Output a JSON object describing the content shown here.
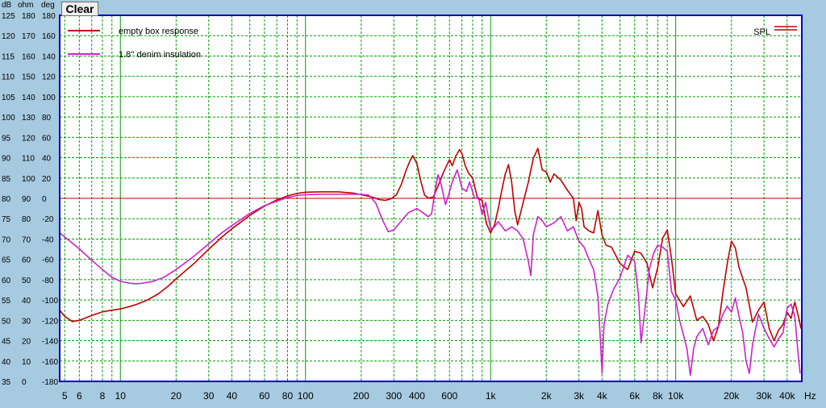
{
  "toolbar": {
    "clear_label": "Clear"
  },
  "axis_headers": {
    "db": "dB",
    "ohm": "ohm",
    "deg": "deg"
  },
  "colors": {
    "background": "#a6cae0",
    "plot_bg": "#ffffff",
    "grid": "#00a000",
    "frame": "#0000c0",
    "empty_box": "#c00000",
    "denim": "#d020d0",
    "reference": "#c00000"
  },
  "chart_data": {
    "type": "line",
    "title": "",
    "xlabel": "Hz",
    "x_scale": "log",
    "xlim": [
      4.7,
      48000
    ],
    "ylim_db": [
      35,
      125
    ],
    "grid": true,
    "legend_position": "top-left",
    "x_ticks": [
      {
        "v": 5,
        "label": "5"
      },
      {
        "v": 6,
        "label": "6"
      },
      {
        "v": 8,
        "label": "8"
      },
      {
        "v": 10,
        "label": "10"
      },
      {
        "v": 20,
        "label": "20"
      },
      {
        "v": 30,
        "label": "30"
      },
      {
        "v": 40,
        "label": "40"
      },
      {
        "v": 60,
        "label": "60"
      },
      {
        "v": 80,
        "label": "80"
      },
      {
        "v": 100,
        "label": "100"
      },
      {
        "v": 200,
        "label": "200"
      },
      {
        "v": 300,
        "label": "300"
      },
      {
        "v": 400,
        "label": "400"
      },
      {
        "v": 600,
        "label": "600"
      },
      {
        "v": 1000,
        "label": "1k"
      },
      {
        "v": 2000,
        "label": "2k"
      },
      {
        "v": 3000,
        "label": "3k"
      },
      {
        "v": 4000,
        "label": "4k"
      },
      {
        "v": 6000,
        "label": "6k"
      },
      {
        "v": 8000,
        "label": "8k"
      },
      {
        "v": 10000,
        "label": "10k"
      },
      {
        "v": 20000,
        "label": "20k"
      },
      {
        "v": 30000,
        "label": "30k"
      },
      {
        "v": 40000,
        "label": "40k"
      }
    ],
    "y_db_ticks": [
      "125",
      "120",
      "115",
      "110",
      "105",
      "100",
      "95",
      "90",
      "85",
      "80",
      "75",
      "70",
      "65",
      "60",
      "55",
      "50",
      "45",
      "40",
      "35"
    ],
    "y_ohm_ticks": [
      "180",
      "170",
      "160",
      "150",
      "140",
      "130",
      "120",
      "110",
      "100",
      "90",
      "80",
      "70",
      "60",
      "50",
      "40",
      "30",
      "20",
      "10",
      "0"
    ],
    "y_deg_ticks": [
      "180",
      "160",
      "140",
      "120",
      "100",
      "80",
      "60",
      "40",
      "20",
      "0",
      "-20",
      "-40",
      "-60",
      "-80",
      "-100",
      "-120",
      "-140",
      "-160",
      "-180"
    ],
    "reference_line_db": 80,
    "reference_label": "SPL",
    "series": [
      {
        "name": "empty box response",
        "color": "#c00000",
        "points": [
          [
            4.7,
            52.5
          ],
          [
            5,
            51
          ],
          [
            5.5,
            49.7
          ],
          [
            6,
            50
          ],
          [
            6.5,
            50.6
          ],
          [
            7,
            51.2
          ],
          [
            8,
            52.1
          ],
          [
            9,
            52.5
          ],
          [
            10,
            52.8
          ],
          [
            11,
            53.3
          ],
          [
            12,
            53.8
          ],
          [
            14,
            55
          ],
          [
            16,
            56.5
          ],
          [
            18,
            58.3
          ],
          [
            20,
            60.2
          ],
          [
            25,
            64
          ],
          [
            30,
            67.5
          ],
          [
            35,
            70.3
          ],
          [
            40,
            72.5
          ],
          [
            50,
            75.8
          ],
          [
            60,
            78.1
          ],
          [
            70,
            79.6
          ],
          [
            80,
            80.6
          ],
          [
            90,
            81.2
          ],
          [
            100,
            81.5
          ],
          [
            120,
            81.6
          ],
          [
            150,
            81.6
          ],
          [
            180,
            81.3
          ],
          [
            200,
            80.9
          ],
          [
            230,
            80.3
          ],
          [
            250,
            79.7
          ],
          [
            270,
            79.5
          ],
          [
            290,
            79.9
          ],
          [
            310,
            80.9
          ],
          [
            330,
            83.5
          ],
          [
            350,
            87
          ],
          [
            370,
            89.6
          ],
          [
            380,
            90.5
          ],
          [
            400,
            88.5
          ],
          [
            420,
            84.2
          ],
          [
            440,
            80.8
          ],
          [
            460,
            80.1
          ],
          [
            490,
            80.3
          ],
          [
            520,
            83
          ],
          [
            560,
            86.7
          ],
          [
            600,
            89.5
          ],
          [
            620,
            88
          ],
          [
            650,
            90.5
          ],
          [
            680,
            92
          ],
          [
            700,
            91
          ],
          [
            730,
            88
          ],
          [
            760,
            86.2
          ],
          [
            800,
            85
          ],
          [
            850,
            80
          ],
          [
            900,
            79.5
          ],
          [
            950,
            73.8
          ],
          [
            1000,
            71.5
          ],
          [
            1050,
            73.5
          ],
          [
            1100,
            77.5
          ],
          [
            1150,
            82
          ],
          [
            1200,
            86
          ],
          [
            1250,
            88.3
          ],
          [
            1300,
            84
          ],
          [
            1350,
            77
          ],
          [
            1400,
            73.5
          ],
          [
            1500,
            79
          ],
          [
            1600,
            84
          ],
          [
            1700,
            89.8
          ],
          [
            1800,
            92.3
          ],
          [
            1900,
            87
          ],
          [
            2000,
            86.5
          ],
          [
            2100,
            84
          ],
          [
            2200,
            86
          ],
          [
            2400,
            84.5
          ],
          [
            2600,
            82
          ],
          [
            2800,
            80
          ],
          [
            2900,
            74.5
          ],
          [
            3000,
            79
          ],
          [
            3100,
            77.5
          ],
          [
            3200,
            73
          ],
          [
            3400,
            72
          ],
          [
            3600,
            71.5
          ],
          [
            3800,
            77
          ],
          [
            4000,
            71
          ],
          [
            4200,
            68.5
          ],
          [
            4500,
            68
          ],
          [
            5000,
            64
          ],
          [
            5500,
            62.5
          ],
          [
            6000,
            67
          ],
          [
            6500,
            66.5
          ],
          [
            7000,
            64
          ],
          [
            7500,
            58
          ],
          [
            8000,
            63
          ],
          [
            8500,
            70.2
          ],
          [
            9000,
            72.2
          ],
          [
            9500,
            65
          ],
          [
            10000,
            56.5
          ],
          [
            11000,
            53.4
          ],
          [
            12000,
            56
          ],
          [
            13000,
            50
          ],
          [
            14000,
            51
          ],
          [
            15000,
            49
          ],
          [
            16000,
            45
          ],
          [
            17000,
            48.5
          ],
          [
            18000,
            57
          ],
          [
            19000,
            64
          ],
          [
            20000,
            69.5
          ],
          [
            21000,
            67.8
          ],
          [
            22000,
            63
          ],
          [
            24000,
            58
          ],
          [
            26000,
            49.6
          ],
          [
            28000,
            52.5
          ],
          [
            30000,
            54.5
          ],
          [
            32000,
            48
          ],
          [
            34000,
            45
          ],
          [
            36000,
            47.6
          ],
          [
            38000,
            49
          ],
          [
            40000,
            52
          ],
          [
            42000,
            50.5
          ],
          [
            44000,
            54.5
          ],
          [
            46000,
            51
          ],
          [
            47500,
            48
          ]
        ]
      },
      {
        "name": "1.8'' denim insulation",
        "color": "#d020d0",
        "points": [
          [
            4.7,
            71.5
          ],
          [
            5,
            70.5
          ],
          [
            6,
            67.6
          ],
          [
            7,
            64.8
          ],
          [
            8,
            62.5
          ],
          [
            9,
            60.6
          ],
          [
            10,
            59.6
          ],
          [
            11,
            59.2
          ],
          [
            12,
            59
          ],
          [
            13,
            59.1
          ],
          [
            15,
            59.6
          ],
          [
            17,
            60.5
          ],
          [
            20,
            62.5
          ],
          [
            25,
            65.8
          ],
          [
            30,
            68.8
          ],
          [
            35,
            71.4
          ],
          [
            40,
            73.3
          ],
          [
            50,
            76.3
          ],
          [
            60,
            78.2
          ],
          [
            70,
            79.3
          ],
          [
            80,
            80.2
          ],
          [
            90,
            80.7
          ],
          [
            100,
            80.9
          ],
          [
            120,
            81
          ],
          [
            150,
            81
          ],
          [
            180,
            81
          ],
          [
            200,
            81
          ],
          [
            220,
            80.8
          ],
          [
            240,
            78.8
          ],
          [
            260,
            74.8
          ],
          [
            280,
            71.8
          ],
          [
            300,
            72.2
          ],
          [
            330,
            74.5
          ],
          [
            360,
            76.5
          ],
          [
            400,
            77.5
          ],
          [
            430,
            76.5
          ],
          [
            460,
            75.5
          ],
          [
            480,
            76.2
          ],
          [
            500,
            81.5
          ],
          [
            520,
            85.8
          ],
          [
            540,
            83.5
          ],
          [
            570,
            78.5
          ],
          [
            590,
            80.5
          ],
          [
            620,
            84
          ],
          [
            660,
            87
          ],
          [
            700,
            82.5
          ],
          [
            740,
            81.7
          ],
          [
            770,
            84
          ],
          [
            820,
            80
          ],
          [
            860,
            80.2
          ],
          [
            900,
            76
          ],
          [
            940,
            79
          ],
          [
            1000,
            72.5
          ],
          [
            1050,
            73
          ],
          [
            1100,
            74.3
          ],
          [
            1200,
            72
          ],
          [
            1300,
            73
          ],
          [
            1400,
            72
          ],
          [
            1500,
            70
          ],
          [
            1600,
            64.5
          ],
          [
            1650,
            61
          ],
          [
            1700,
            71
          ],
          [
            1800,
            75.5
          ],
          [
            1900,
            74.5
          ],
          [
            2000,
            73
          ],
          [
            2200,
            74
          ],
          [
            2400,
            75.5
          ],
          [
            2600,
            72
          ],
          [
            2800,
            73
          ],
          [
            3000,
            69.5
          ],
          [
            3200,
            68
          ],
          [
            3400,
            65
          ],
          [
            3600,
            62.5
          ],
          [
            3800,
            56
          ],
          [
            3900,
            47
          ],
          [
            4000,
            37
          ],
          [
            4100,
            49
          ],
          [
            4300,
            54
          ],
          [
            4600,
            57.5
          ],
          [
            5000,
            60.5
          ],
          [
            5500,
            66
          ],
          [
            6000,
            64.5
          ],
          [
            6300,
            56
          ],
          [
            6500,
            44.5
          ],
          [
            6800,
            52
          ],
          [
            7200,
            62.5
          ],
          [
            7600,
            66.5
          ],
          [
            8000,
            68.5
          ],
          [
            8500,
            68
          ],
          [
            9000,
            67
          ],
          [
            9500,
            57
          ],
          [
            10000,
            55
          ],
          [
            10500,
            50
          ],
          [
            11000,
            46.5
          ],
          [
            11500,
            43
          ],
          [
            12000,
            36.5
          ],
          [
            12500,
            43
          ],
          [
            13000,
            46
          ],
          [
            14000,
            48
          ],
          [
            15000,
            44
          ],
          [
            16000,
            47.5
          ],
          [
            17000,
            48.5
          ],
          [
            18000,
            51.5
          ],
          [
            19000,
            53.5
          ],
          [
            20000,
            52
          ],
          [
            21000,
            55.5
          ],
          [
            22000,
            51
          ],
          [
            23000,
            47
          ],
          [
            24000,
            40
          ],
          [
            25000,
            37
          ],
          [
            26000,
            44
          ],
          [
            28000,
            51.5
          ],
          [
            30000,
            48
          ],
          [
            32000,
            45.5
          ],
          [
            34000,
            43.5
          ],
          [
            36000,
            45.5
          ],
          [
            38000,
            47
          ],
          [
            40000,
            53
          ],
          [
            42000,
            54
          ],
          [
            44000,
            51
          ],
          [
            46000,
            41
          ],
          [
            47000,
            37
          ]
        ]
      }
    ]
  }
}
